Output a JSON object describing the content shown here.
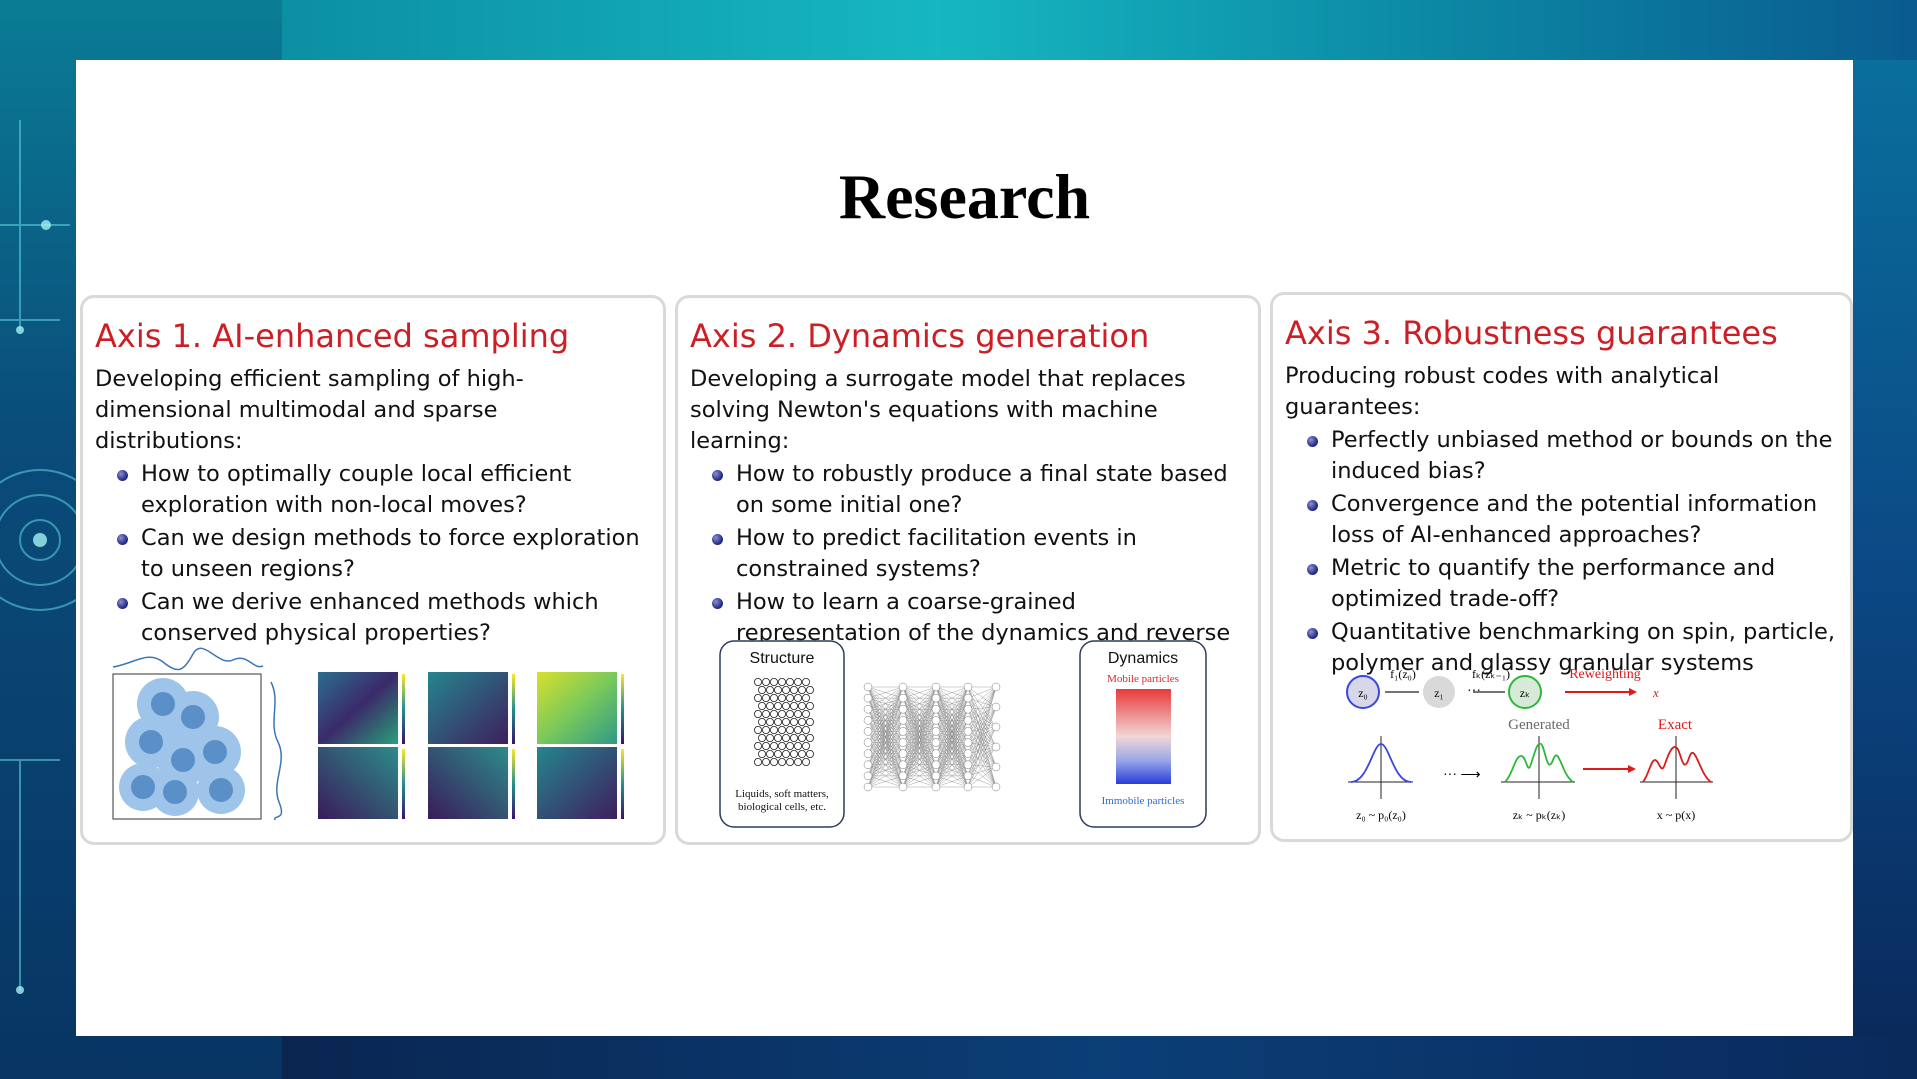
{
  "slide": {
    "title": "Research"
  },
  "axes": [
    {
      "title": "Axis 1.  AI-enhanced sampling",
      "intro": "Developing efficient sampling of high-dimensional multimodal and sparse distributions:",
      "bullets": [
        "How to optimally couple local efficient exploration with non-local moves?",
        "Can we design methods to force exploration to unseen regions?",
        "Can we derive enhanced methods which conserved physical properties?"
      ]
    },
    {
      "title": "Axis 2.  Dynamics generation",
      "intro": "Developing a surrogate model that replaces solving Newton's equations with machine learning:",
      "bullets": [
        "How to robustly produce a final state based on some initial one?",
        "How to predict facilitation events in constrained systems?",
        "How to learn a coarse-grained representation of the dynamics and reverse it down?"
      ],
      "figure": {
        "structure_label": "Structure",
        "structure_caption_1": "Liquids, soft matters,",
        "structure_caption_2": "biological cells, etc.",
        "dynamics_label": "Dynamics",
        "mobile_label": "Mobile particles",
        "immobile_label": "Immobile particles"
      }
    },
    {
      "title": "Axis 3.  Robustness guarantees",
      "intro": "Producing robust codes with analytical guarantees:",
      "bullets": [
        "Perfectly unbiased method or bounds on the induced bias?",
        "Convergence and the potential information loss of AI-enhanced approaches?",
        "Metric to quantify the performance and optimized trade-off?",
        "Quantitative benchmarking on spin, particle, polymer and glassy granular systems"
      ],
      "figure": {
        "reweighting_label": "Reweighting",
        "generated_label": "Generated",
        "exact_label": "Exact",
        "z0": "z₀",
        "z1": "z₁",
        "zk": "zₖ",
        "f1": "f₁(z₀)",
        "fk": "fₖ(zₖ₋₁)",
        "x": "x",
        "dist0": "z₀ ~ p₀(z₀)",
        "distk": "zₖ ~ pₖ(zₖ)",
        "distx": "x ~ p(x)"
      }
    }
  ],
  "colors": {
    "axis_title": "#cc1f25",
    "bullet": "#2a2f8a",
    "reweight": "#e0191b",
    "generated": "#2db83a"
  }
}
